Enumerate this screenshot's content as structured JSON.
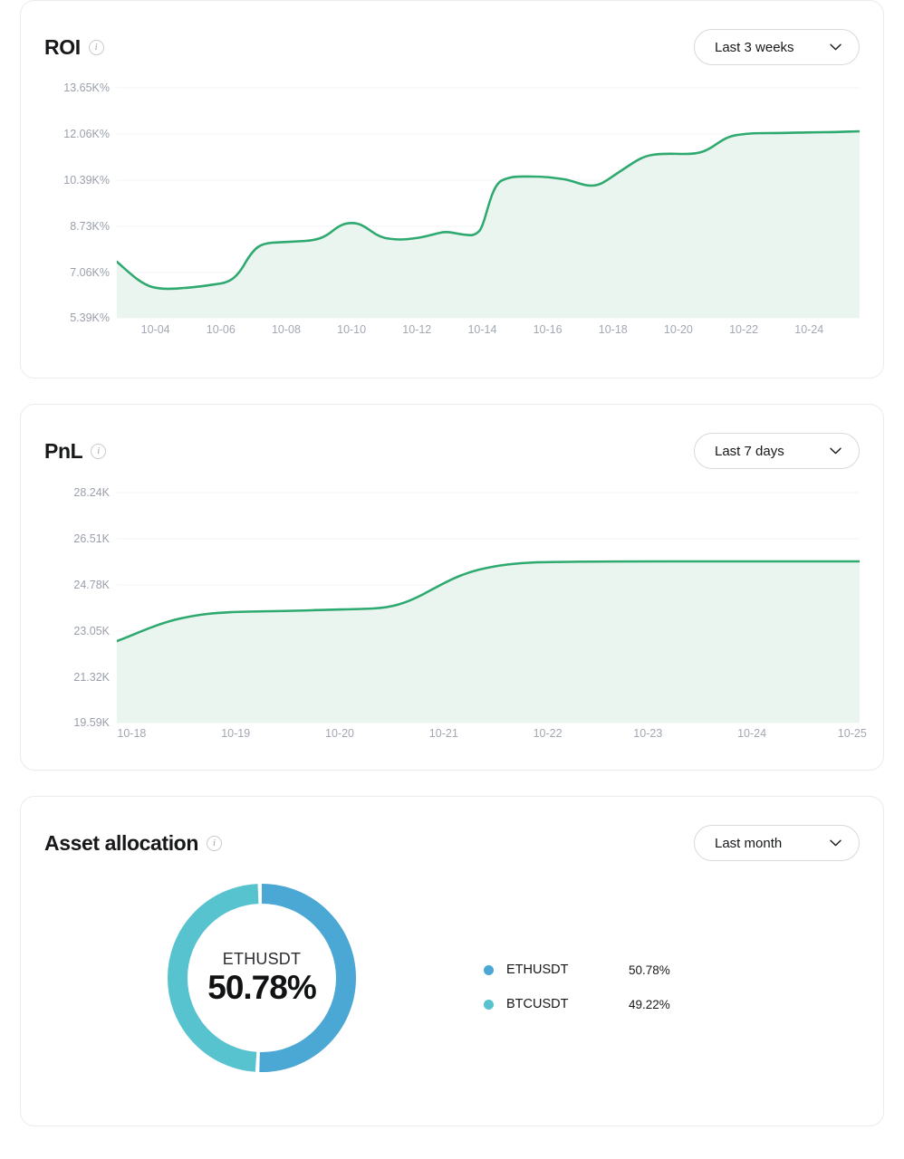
{
  "cards": [
    {
      "id": "roi",
      "title": "ROI",
      "info_icon": "info-icon",
      "selector": {
        "label": "Last 3 weeks",
        "chevron": "chevron-down-icon"
      }
    },
    {
      "id": "pnl",
      "title": "PnL",
      "info_icon": "info-icon",
      "selector": {
        "label": "Last 7 days",
        "chevron": "chevron-down-icon"
      }
    },
    {
      "id": "allocation",
      "title": "Asset allocation",
      "info_icon": "info-icon",
      "selector": {
        "label": "Last month",
        "chevron": "chevron-down-icon"
      }
    }
  ],
  "allocation": {
    "center_symbol": "ETHUSDT",
    "center_percent": "50.78%",
    "legend": [
      {
        "name": "ETHUSDT",
        "value": "50.78%",
        "color": "#4BA7D3"
      },
      {
        "name": "BTCUSDT",
        "value": "49.22%",
        "color": "#57C3CE"
      }
    ]
  },
  "colors": {
    "line": "#2EA96F",
    "area": "#EAF5EF",
    "grid": "#F2F4F6",
    "card_border": "#EBEBEB",
    "axis_text": "#9AA0AB"
  },
  "chart_data": [
    {
      "type": "area",
      "title": "ROI",
      "xlabel": "",
      "ylabel": "",
      "unit": "K%",
      "grid": true,
      "legend": "none",
      "ylim": [
        5.39,
        13.65
      ],
      "ytick_labels": [
        "13.65K%",
        "12.06K%",
        "10.39K%",
        "8.73K%",
        "7.06K%",
        "5.39K%"
      ],
      "ytick_values": [
        13.65,
        12.06,
        10.39,
        8.73,
        7.06,
        5.39
      ],
      "xtick_labels": [
        "10-04",
        "10-06",
        "10-08",
        "10-10",
        "10-12",
        "10-14",
        "10-16",
        "10-18",
        "10-20",
        "10-22",
        "10-24"
      ],
      "x": [
        "10-04",
        "10-05",
        "10-06",
        "10-07",
        "10-08",
        "10-09",
        "10-10",
        "10-11",
        "10-12",
        "10-13",
        "10-14",
        "10-15",
        "10-16",
        "10-17",
        "10-18",
        "10-19",
        "10-20",
        "10-21",
        "10-22",
        "10-23",
        "10-24",
        "10-25"
      ],
      "values": [
        7.1,
        6.72,
        6.73,
        6.8,
        7.55,
        7.62,
        7.95,
        7.72,
        7.78,
        8.3,
        8.22,
        10.55,
        10.62,
        10.35,
        10.4,
        11.2,
        11.22,
        11.78,
        11.85,
        11.85,
        11.87,
        11.88
      ]
    },
    {
      "type": "area",
      "title": "PnL",
      "xlabel": "",
      "ylabel": "",
      "unit": "K",
      "grid": true,
      "legend": "none",
      "ylim": [
        19.59,
        28.24
      ],
      "ytick_labels": [
        "28.24K",
        "26.51K",
        "24.78K",
        "23.05K",
        "21.32K",
        "19.59K"
      ],
      "ytick_values": [
        28.24,
        26.51,
        24.78,
        23.05,
        21.32,
        19.59
      ],
      "xtick_labels": [
        "10-18",
        "10-19",
        "10-20",
        "10-21",
        "10-22",
        "10-23",
        "10-24",
        "10-25"
      ],
      "x": [
        "10-18",
        "10-19",
        "10-20",
        "10-21",
        "10-22",
        "10-23",
        "10-24",
        "10-25"
      ],
      "values": [
        22.7,
        23.45,
        23.5,
        23.58,
        24.85,
        24.9,
        24.92,
        24.92
      ]
    },
    {
      "type": "pie",
      "title": "Asset allocation",
      "labels": [
        "ETHUSDT",
        "BTCUSDT"
      ],
      "values": [
        50.78,
        49.22
      ],
      "colors": [
        "#4BA7D3",
        "#57C3CE"
      ],
      "legend": "right",
      "donut": true
    }
  ]
}
